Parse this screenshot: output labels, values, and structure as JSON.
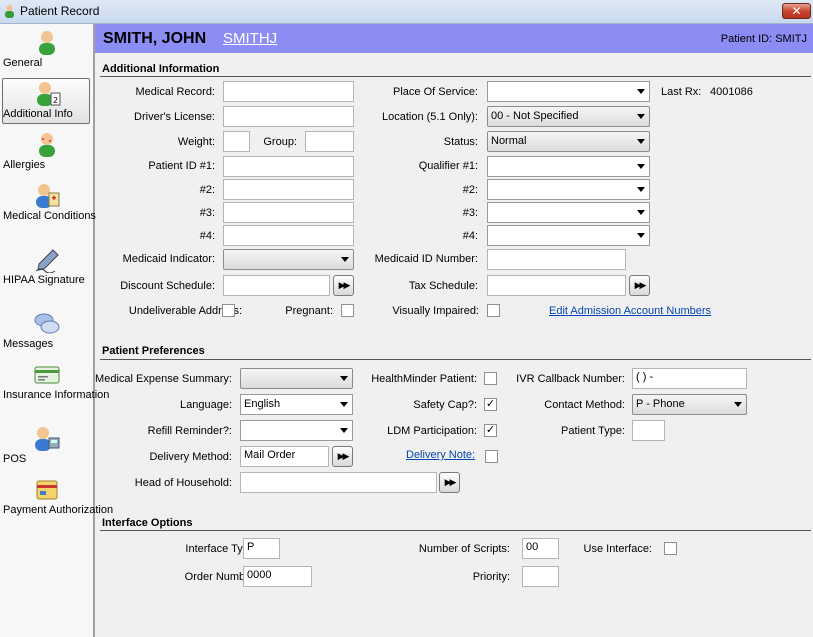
{
  "window": {
    "title": "Patient Record",
    "close_label": "✕"
  },
  "sidebar": {
    "items": [
      {
        "label": "General"
      },
      {
        "label": "Additional Info"
      },
      {
        "label": "Allergies"
      },
      {
        "label": "Medical Conditions"
      },
      {
        "label": "HIPAA Signature"
      },
      {
        "label": "Messages"
      },
      {
        "label": "Insurance Information"
      },
      {
        "label": "POS"
      },
      {
        "label": "Payment Authorization"
      }
    ]
  },
  "header": {
    "name": "SMITH, JOHN",
    "code": "SMITHJ",
    "patient_id": "Patient ID: SMITJ"
  },
  "additional": {
    "title": "Additional Information",
    "medical_record_label": "Medical Record:",
    "medical_record": "",
    "drivers_license_label": "Driver's License:",
    "drivers_license": "",
    "weight_label": "Weight:",
    "weight": "",
    "group_label": "Group:",
    "group": "",
    "patient_id1_label": "Patient ID #1:",
    "patient_id1": "",
    "id2_label": "#2:",
    "id3_label": "#3:",
    "id4_label": "#4:",
    "medicaid_indicator_label": "Medicaid Indicator:",
    "medicaid_indicator": "",
    "discount_schedule_label": "Discount Schedule:",
    "discount_schedule": "",
    "undeliverable_label": "Undeliverable Address:",
    "pregnant_label": "Pregnant:",
    "place_of_service_label": "Place Of Service:",
    "place_of_service": "",
    "location_label": "Location (5.1 Only):",
    "location": "00 - Not Specified",
    "status_label": "Status:",
    "status": "Normal",
    "qualifier1_label": "Qualifier #1:",
    "q2_label": "#2:",
    "q3_label": "#3:",
    "q4_label": "#4:",
    "medicaid_id_label": "Medicaid ID Number:",
    "medicaid_id": "",
    "tax_schedule_label": "Tax Schedule:",
    "tax_schedule": "",
    "visually_impaired_label": "Visually Impaired:",
    "last_rx_label": "Last Rx:",
    "last_rx": "4001086",
    "edit_admission_link": "Edit Admission Account Numbers"
  },
  "preferences": {
    "title": "Patient Preferences",
    "med_expense_label": "Medical Expense Summary:",
    "med_expense": "",
    "language_label": "Language:",
    "language": "English",
    "refill_label": "Refill Reminder?:",
    "refill": "",
    "delivery_method_label": "Delivery Method:",
    "delivery_method": "Mail Order",
    "head_household_label": "Head of Household:",
    "head_household": "",
    "healthminder_label": "HealthMinder Patient:",
    "healthminder_checked": false,
    "safety_cap_label": "Safety Cap?:",
    "safety_cap_checked": true,
    "ldm_label": "LDM Participation:",
    "ldm_checked": true,
    "delivery_note_link": "Delivery Note:",
    "delivery_note_checked": false,
    "ivr_label": "IVR Callback Number:",
    "ivr": "(   )    -",
    "contact_method_label": "Contact Method:",
    "contact_method": "P - Phone",
    "patient_type_label": "Patient Type:",
    "patient_type": ""
  },
  "interface": {
    "title": "Interface Options",
    "interface_type_label": "Interface Type:",
    "interface_type": "P",
    "order_number_label": "Order Number:",
    "order_number": "0000",
    "num_scripts_label": "Number of Scripts:",
    "num_scripts": "00",
    "priority_label": "Priority:",
    "priority": "",
    "use_interface_label": "Use Interface:"
  },
  "colors": {
    "header_bg": "#8c8cf5",
    "link": "#0645ad"
  }
}
